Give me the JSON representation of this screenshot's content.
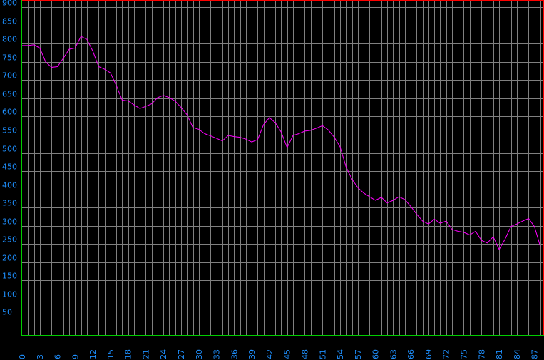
{
  "chart_data": {
    "type": "line",
    "title": "",
    "xlabel": "",
    "ylabel": "",
    "xlim": [
      0,
      88.5
    ],
    "ylim": [
      0,
      920
    ],
    "y_ticks": [
      50,
      100,
      150,
      200,
      250,
      300,
      350,
      400,
      450,
      500,
      550,
      600,
      650,
      700,
      750,
      800,
      850,
      900
    ],
    "x_ticks": [
      "0",
      "3",
      "6",
      "9",
      "12",
      "15",
      "18",
      "21",
      "24",
      "27",
      "30",
      "33",
      "36",
      "39",
      "42",
      "45",
      "48",
      "51",
      "54",
      "57",
      "60",
      "63",
      "66",
      "69",
      "72",
      "75",
      "78",
      "81",
      "84",
      "87"
    ],
    "grid": true,
    "series": [
      {
        "color": "#ff00ff",
        "x": [
          0,
          1,
          2,
          3,
          4,
          5,
          6,
          7,
          8,
          9,
          10,
          11,
          12,
          13,
          14,
          15,
          16,
          17,
          18,
          19,
          20,
          21,
          22,
          23,
          24,
          25,
          26,
          27,
          28,
          29,
          30,
          31,
          32,
          33,
          34,
          35,
          36,
          37,
          38,
          39,
          40,
          41,
          42,
          43,
          44,
          45,
          46,
          47,
          48,
          49,
          50,
          51,
          52,
          53,
          54,
          55,
          56,
          57,
          58,
          59,
          60,
          61,
          62,
          63,
          64,
          65,
          66,
          67,
          68,
          69,
          70,
          71,
          72,
          73,
          74,
          75,
          76,
          77,
          78,
          79,
          80,
          81,
          82,
          83,
          84,
          85,
          86,
          87,
          88
        ],
        "y": [
          795,
          795,
          797,
          788,
          750,
          735,
          737,
          760,
          785,
          788,
          820,
          812,
          780,
          737,
          730,
          720,
          685,
          645,
          643,
          632,
          622,
          628,
          635,
          652,
          658,
          652,
          642,
          625,
          605,
          570,
          565,
          553,
          547,
          540,
          533,
          548,
          545,
          543,
          538,
          530,
          537,
          578,
          597,
          583,
          557,
          515,
          548,
          553,
          560,
          562,
          568,
          575,
          563,
          543,
          517,
          462,
          428,
          405,
          390,
          380,
          370,
          378,
          363,
          370,
          380,
          372,
          353,
          332,
          313,
          305,
          318,
          307,
          313,
          290,
          285,
          282,
          275,
          285,
          260,
          253,
          270,
          235,
          263,
          298,
          305,
          313,
          320,
          298,
          243
        ]
      }
    ]
  }
}
